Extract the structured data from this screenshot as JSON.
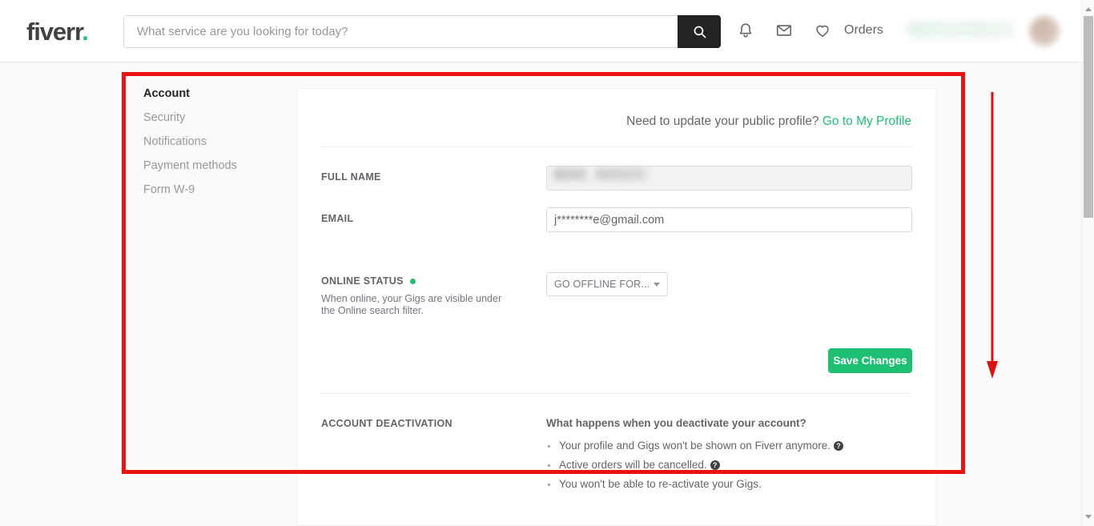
{
  "header": {
    "logo_text": "fiverr",
    "logo_dot": ".",
    "search_placeholder": "What service are you looking for today?",
    "search_value": "",
    "search_button_icon": "search-icon",
    "icons": [
      {
        "name": "notifications-bell-icon",
        "label": "Notifications"
      },
      {
        "name": "inbox-envelope-icon",
        "label": "Inbox"
      },
      {
        "name": "favorites-heart-icon",
        "label": "Lists"
      }
    ],
    "orders_label": "Orders",
    "username_blurred": "",
    "avatar_blurred": ""
  },
  "sidebar": {
    "items": [
      {
        "label": "Account",
        "active": true
      },
      {
        "label": "Security",
        "active": false
      },
      {
        "label": "Notifications",
        "active": false
      },
      {
        "label": "Payment methods",
        "active": false
      },
      {
        "label": "Form W-9",
        "active": false
      }
    ]
  },
  "main": {
    "profile_prompt": "Need to update your public profile?",
    "profile_link": "Go to My Profile",
    "fields": {
      "full_name_label": "FULL NAME",
      "full_name_value": "",
      "email_label": "EMAIL",
      "email_value": "j********e@gmail.com"
    },
    "online_status": {
      "label": "ONLINE STATUS",
      "dot_color": "#1dbf73",
      "help_text": "When online, your Gigs are visible under the Online search filter.",
      "select_value": "GO OFFLINE FOR...",
      "select_options": [
        "GO OFFLINE FOR..."
      ]
    },
    "save_button_label": "Save Changes",
    "deactivation": {
      "section_label": "ACCOUNT DEACTIVATION",
      "question": "What happens when you deactivate your account?",
      "bullets": [
        {
          "text": "Your profile and Gigs won't be shown on Fiverr anymore.",
          "has_help": true
        },
        {
          "text": "Active orders will be cancelled.",
          "has_help": true
        },
        {
          "text": "You won't be able to re-activate your Gigs.",
          "has_help": false
        }
      ],
      "help_glyph": "?"
    }
  },
  "annotation": {
    "color": "#ee1111",
    "box_name": "highlight-rectangle",
    "arrow_name": "scroll-down-arrow"
  },
  "scrollbar": {
    "up_arrow": "scroll-up-arrow",
    "down_arrow": "scroll-down-arrow",
    "thumb": "scrollbar-thumb"
  }
}
